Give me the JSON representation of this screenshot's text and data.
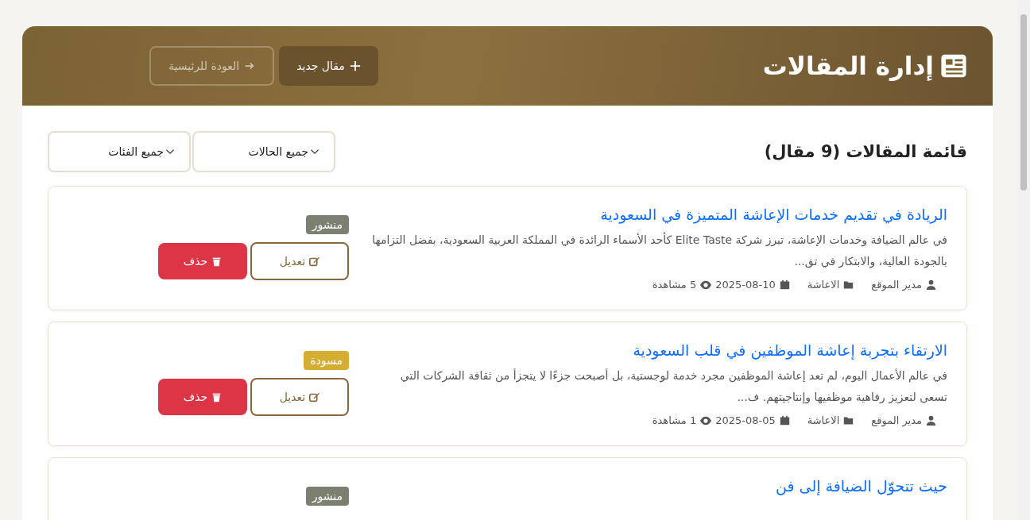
{
  "header": {
    "title": "إدارة المقالات",
    "buttons": [
      {
        "label": "مقال جديد",
        "kind": "new",
        "faded": false
      },
      {
        "label": "العودة للرئيسية",
        "kind": "back",
        "faded": true
      }
    ]
  },
  "list": {
    "heading": "قائمة المقالات (9 مقال)",
    "filters": [
      {
        "value": "جميع الحالات"
      },
      {
        "value": "جميع الفئات"
      }
    ]
  },
  "articles": [
    {
      "title": "الريادة في تقديم خدمات الإعاشة المتميزة في السعودية",
      "excerpt": "في عالم الضيافة وخدمات الإعاشة، تبرز شركة Elite Taste كأحد الأسماء الرائدة في المملكة العربية السعودية، بفضل التزامها بالجودة العالية، والابتكار في تق...",
      "author": "مدير الموقع",
      "category": "الاعاشة",
      "date": "2025-08-10",
      "views": "5 مشاهدة",
      "kind": "published",
      "badge": "منشور",
      "edit": "تعديل",
      "delete": "حذف"
    },
    {
      "title": "الارتقاء بتجربة إعاشة الموظفين في قلب السعودية",
      "excerpt": "في عالم الأعمال اليوم، لم تعد إعاشة الموظفين مجرد خدمة لوجستية، بل أصبحت جزءًا لا يتجزأ من ثقافة الشركات التي تسعى لتعزيز رفاهية موظفيها وإنتاجيتهم. ف...",
      "author": "مدير الموقع",
      "category": "الاعاشة",
      "date": "2025-08-05",
      "views": "1 مشاهدة",
      "kind": "draft",
      "badge": "مسودة",
      "edit": "تعديل",
      "delete": "حذف"
    },
    {
      "title": "حيث تتحوّل الضيافة إلى فن",
      "kind": "published",
      "badge": "منشور"
    }
  ]
}
